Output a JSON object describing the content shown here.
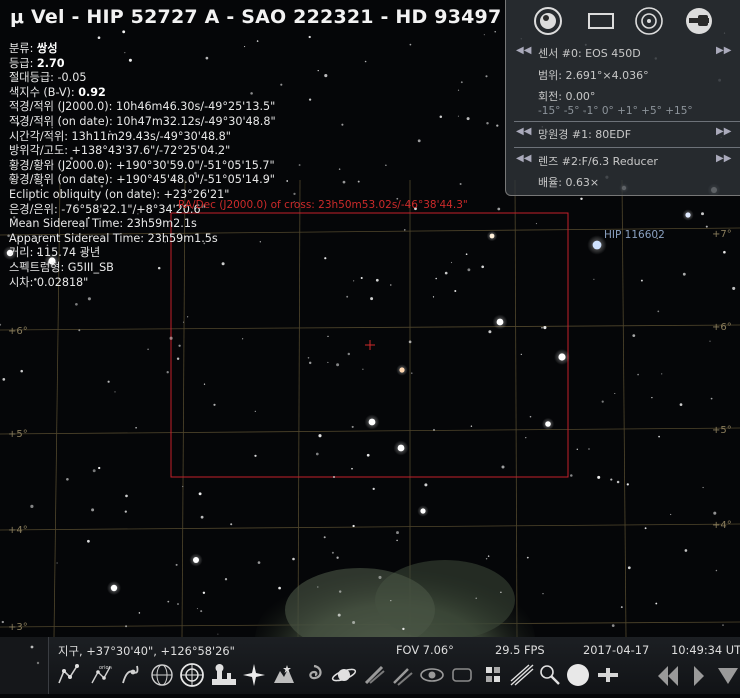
{
  "title": "μ Vel - HIP 52727 A - SAO 222321 - HD 93497",
  "info": {
    "type_label": "분류:",
    "type_value": "쌍성",
    "mag_label": "등급:",
    "mag_value": "2.70",
    "absmag": "절대등급: -0.05",
    "bv_label": "색지수 (B-V):",
    "bv_value": "0.92",
    "radec_j2000": "적경/적위 (J2000.0): 10h46m46.30s/-49°25'13.5\"",
    "radec_date": "적경/적위 (on date): 10h47m32.12s/-49°30'48.8\"",
    "hour_angle": "시간각/적위: 13h11m29.43s/-49°30'48.8\"",
    "azalt": "방위각/고도: +138°43'37.6\"/-72°25'04.2\"",
    "ecl_j2000": "황경/황위 (J2000.0): +190°30'59.0\"/-51°05'15.7\"",
    "ecl_date": "황경/황위 (on date): +190°45'48.0\"/-51°05'14.9\"",
    "obliquity": "Ecliptic obliquity (on date): +23°26'21\"",
    "gal": "은경/은위: -76°58'22.1\"/+8°34'20.6\"",
    "mean_sidereal": "Mean Sidereal Time: 23h59m2.1s",
    "app_sidereal": "Apparent Sidereal Time: 23h59m1.5s",
    "distance": "거리: 115.74 광년",
    "spectral": "스펙트럼형: G5III_SB",
    "parallax": "시차: 0.02818\""
  },
  "crosshair_label": "RA/Dec (J2000.0) of cross: 23h50m53.02s/-46°38'44.3\"",
  "star_label": "HIP 116602",
  "grid_labels": [
    "+7°",
    "+6°",
    "+5°",
    "+4°",
    "+3°"
  ],
  "ocular": {
    "sensor": "센서 #0: EOS 450D",
    "range": "범위: 2.691°×4.036°",
    "rotation": "회전: 0.00°",
    "rotation_scale": "-15° -5° -1° 0° +1° +5° +15°",
    "telescope": "망원경 #1: 80EDF",
    "lens": "렌즈 #2:F/6.3 Reducer",
    "magnification": "배율: 0.63×"
  },
  "status": {
    "location": "지구, +37°30'40\", +126°58'26\"",
    "fov": "FOV 7.06°",
    "fps": "29.5 FPS",
    "date": "2017-04-17",
    "time": "10:49:34 UT"
  },
  "toolbar": {
    "items": [
      "constellation-lines-icon",
      "constellation-labels-icon",
      "constellation-art-icon",
      "equatorial-grid-icon",
      "azimuthal-grid-icon",
      "ground-icon",
      "cardinal-points-icon",
      "atmosphere-icon",
      "nebulae-icon",
      "planets-icon",
      "equatorial-mount-icon",
      "center-icon",
      "night-mode-icon",
      "fullscreen-icon",
      "oculars-icon",
      "satellites-icon",
      "telescope-icon",
      "sensor-icon",
      "ocular-toggle-icon",
      "crosshair-icon"
    ]
  },
  "colors": {
    "frame": "#c4202a",
    "grid": "#6d5e3c",
    "accent": "#cc2a2a"
  }
}
